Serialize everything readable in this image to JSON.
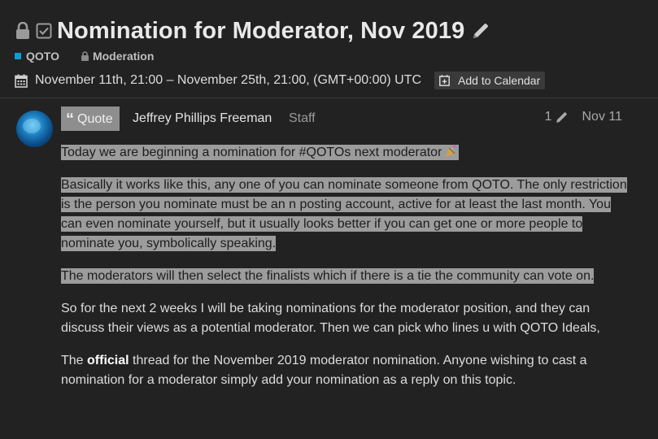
{
  "topic": {
    "title": "Nomination for Moderator, Nov 2019",
    "icons": [
      "lock-icon",
      "checkbox-icon",
      "pencil-icon"
    ]
  },
  "categories": [
    {
      "label": "QOTO",
      "color": "#0e9bd8"
    },
    {
      "label": "Moderation",
      "locked": true
    }
  ],
  "event": {
    "dates": "November 11th, 21:00 – November 25th, 21:00, (GMT+00:00) UTC",
    "add_to_calendar": "Add to Calendar"
  },
  "post": {
    "quote_label": "Quote",
    "username": "Jeffrey Phillips Freeman",
    "user_title": "Staff",
    "edit_count": "1",
    "date": "Nov 11",
    "paragraph_1": "Today we are beginning a nomination for #QOTOs next moderator",
    "paragraph_2": "Basically it works like this, any one of you can nominate someone from QOTO. The only restriction is the person you nominate must be an n posting account, active for at least the last month. You can even nominate yourself, but it usually looks better if you can get one or more people to nominate you, symbolically speaking.",
    "paragraph_3": "The moderators will then select the finalists which if there is a tie the community can vote on.",
    "paragraph_4": "So for the next 2 weeks I will be taking nominations for the moderator position, and they can discuss their views as a potential moderator. Then we can pick who lines u with QOTO Ideals,",
    "paragraph_5_prefix": "The ",
    "paragraph_5_bold": "official",
    "paragraph_5_suffix": " thread for the November 2019 moderator nomination. Anyone wishing to cast a nomination for a moderator simply add your nomination as a reply on this topic."
  },
  "colors": {
    "background": "#222222",
    "highlight": "#9c9c9c",
    "category_accent": "#0e9bd8"
  }
}
